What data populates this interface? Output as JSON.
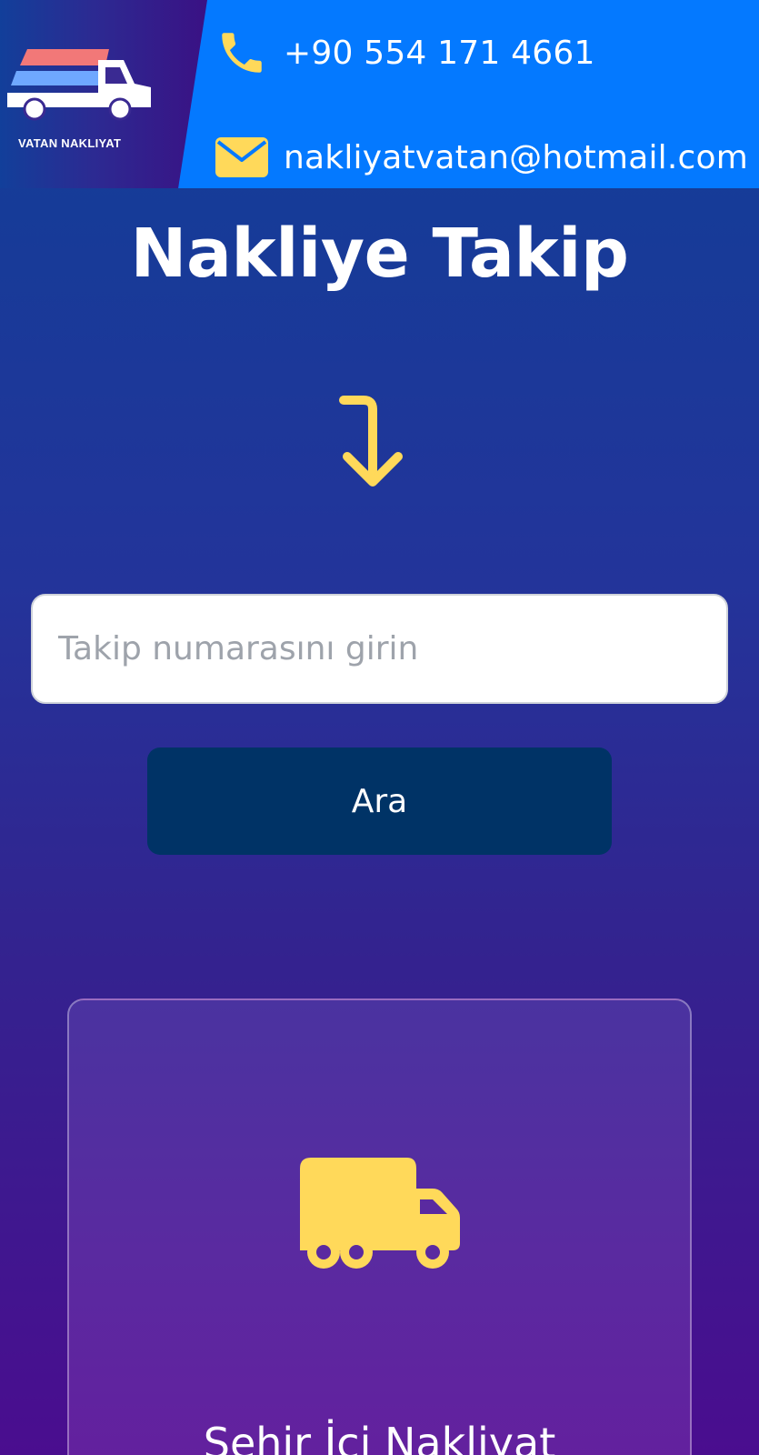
{
  "header": {
    "logo_text": "VATAN NAKLIYAT",
    "phone": "+90 554 171 4661",
    "email": "nakliyatvatan@hotmail.com"
  },
  "main": {
    "title": "Nakliye Takip",
    "search": {
      "placeholder": "Takip numarasını girin",
      "value": ""
    },
    "search_button_label": "Ara"
  },
  "services": [
    {
      "title": "Şehir İçi Nakliyat",
      "icon": "truck-icon"
    }
  ],
  "colors": {
    "header_blue": "#0479ff",
    "accent_yellow": "#ffd95a",
    "button_navy": "#003366",
    "logo_red": "#f27878",
    "logo_blue": "#6fa8ff"
  }
}
